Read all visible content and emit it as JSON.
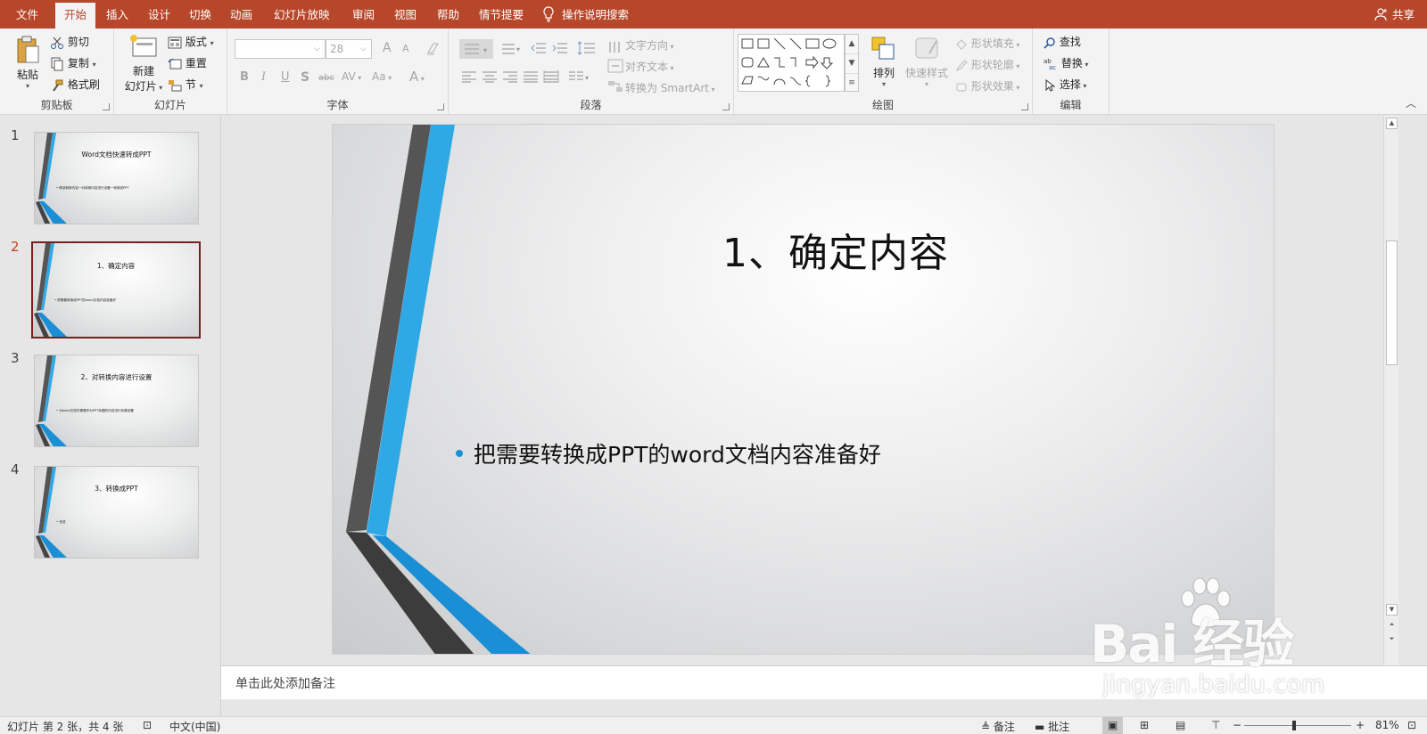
{
  "tabs": [
    "文件",
    "开始",
    "插入",
    "设计",
    "切换",
    "动画",
    "幻灯片放映",
    "审阅",
    "视图",
    "帮助",
    "情节提要"
  ],
  "active_tab": "开始",
  "tell_me": "操作说明搜索",
  "share": "共享",
  "ribbon": {
    "clipboard": {
      "label": "剪贴板",
      "paste": "粘贴",
      "cut": "剪切",
      "copy": "复制",
      "format_painter": "格式刷"
    },
    "slides": {
      "label": "幻灯片",
      "new_slide_1": "新建",
      "new_slide_2": "幻灯片",
      "layout": "版式",
      "reset": "重置",
      "section": "节"
    },
    "font": {
      "label": "字体",
      "font_size": "28",
      "bold": "B",
      "italic": "I",
      "underline": "U",
      "shadow": "S",
      "strike": "abc",
      "spacing": "AV",
      "case": "Aa",
      "color": "A",
      "grow": "A",
      "shrink": "A"
    },
    "paragraph": {
      "label": "段落",
      "text_direction": "文字方向",
      "align_text": "对齐文本",
      "smartart": "转换为 SmartArt"
    },
    "drawing": {
      "label": "绘图",
      "arrange": "排列",
      "quick_styles": "快速样式",
      "shape_fill": "形状填充",
      "shape_outline": "形状轮廓",
      "shape_effects": "形状效果"
    },
    "editing": {
      "label": "编辑",
      "find": "查找",
      "replace": "替换",
      "select": "选择"
    }
  },
  "thumbnails": [
    {
      "num": "1",
      "title": "Word文档快速转成PPT",
      "bullet": "• 精选转换内容一对转换内容进行设置一转换成PPT"
    },
    {
      "num": "2",
      "title": "1、确定内容",
      "bullet": "• 把需要转换成PPT的word文档内容准备好"
    },
    {
      "num": "3",
      "title": "2、对转换内容进行设置",
      "bullet": "• 对word文档内需要作为PPT标题的内容进行标题设置"
    },
    {
      "num": "4",
      "title": "3、转换成PPT",
      "bullet": "• 完成"
    }
  ],
  "current_slide": {
    "title": "1、确定内容",
    "bullet": "把需要转换成PPT的word文档内容准备好"
  },
  "notes_placeholder": "单击此处添加备注",
  "status": {
    "slide_info": "幻灯片 第 2 张，共 4 张",
    "language": "中文(中国)",
    "notes": "备注",
    "comments": "批注",
    "zoom": "81%",
    "minus": "−",
    "plus": "+"
  },
  "watermark": {
    "brand": "Bai 经验",
    "url": "jingyan.baidu.com"
  },
  "colors": {
    "accent": "#b7472a",
    "bullet": "#1b8fd6",
    "stripe_blue": "#2fa8e6",
    "stripe_gray": "#555555"
  }
}
